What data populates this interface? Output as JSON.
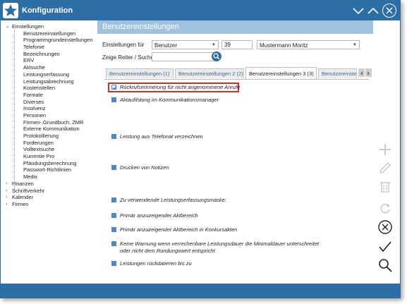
{
  "window": {
    "title": "Konfiguration",
    "controls": {
      "minimize": "chevron-down-icon",
      "maximize": "chevron-up-icon",
      "close": "close-icon"
    }
  },
  "sidebar": {
    "items": [
      {
        "label": "Einstellungen",
        "level": 0,
        "expanded": true
      },
      {
        "label": "Benutzereinstellungen",
        "level": 1
      },
      {
        "label": "Programmgrundeinstellungen",
        "level": 1
      },
      {
        "label": "Telefonie",
        "level": 1
      },
      {
        "label": "Bezeichnungen",
        "level": 1
      },
      {
        "label": "ERV",
        "level": 1
      },
      {
        "label": "Aktsuche",
        "level": 1
      },
      {
        "label": "Leistungserfassung",
        "level": 1
      },
      {
        "label": "Leistungsabrechnung",
        "level": 1
      },
      {
        "label": "Kostenstellen",
        "level": 1
      },
      {
        "label": "Formate",
        "level": 1
      },
      {
        "label": "Diverses",
        "level": 1
      },
      {
        "label": "Insolvenz",
        "level": 1
      },
      {
        "label": "Personen",
        "level": 1
      },
      {
        "label": "Firmen-,Grundbuch, ZMR",
        "level": 1
      },
      {
        "label": "Externe Kommunikation",
        "level": 1
      },
      {
        "label": "Protokollierung",
        "level": 1
      },
      {
        "label": "Forderungen",
        "level": 1
      },
      {
        "label": "Volltextsuche",
        "level": 1
      },
      {
        "label": "Kurrentie Pro",
        "level": 1
      },
      {
        "label": "Pfändungsberechnung",
        "level": 1
      },
      {
        "label": "Passwort-Richtlinien",
        "level": 1
      },
      {
        "label": "Medix",
        "level": 1
      },
      {
        "label": "Finanzen",
        "level": 0,
        "expanded": false
      },
      {
        "label": "Schriftverkehr",
        "level": 0,
        "expanded": false
      },
      {
        "label": "Kalender",
        "level": 0,
        "expanded": false
      },
      {
        "label": "Firmen",
        "level": 0,
        "expanded": false
      }
    ]
  },
  "panel": {
    "title": "Benutzereinstellungen",
    "settings_for_label": "Einstellungen für",
    "settings_for_value": "Benutzer",
    "user_id": "39",
    "user_name": "Mustermann Moritz",
    "search_label": "Zeige Reiter / Suche",
    "search_value": ""
  },
  "tabs": [
    {
      "label": "Benutzereinstellungen (1)",
      "active": false
    },
    {
      "label": "Benutzereinstellungen 2 (2)",
      "active": false
    },
    {
      "label": "Benutzereinstellungen 3 (3)",
      "active": true
    },
    {
      "label": "Benutzereinste",
      "active": false
    }
  ],
  "options": [
    {
      "label": "Rückrufserinnerung für nicht angenommene Anrufe",
      "checked": true,
      "highlighted": true
    },
    {
      "label": "Aktaufilstung im Kommunikationsmanager"
    },
    {
      "label": "Leistung aus Telefonat verzeichnen"
    },
    {
      "label": "Drucken von Notizen"
    },
    {
      "label": "Zu verwendende Leistungserfassungsmaske:"
    },
    {
      "label": "Primär anzuzeigender Aktbereich"
    },
    {
      "label": "Primär anzuzeigender Aktbereich in Konkursakten"
    },
    {
      "label": "Keine Warnung wenn verrechenbare Leistungsdauer die Minimaldauer unterschreitet",
      "label2": "oder nicht dem Rundungswert entspricht"
    },
    {
      "label": "Leistungen rückdatieren bis zu"
    }
  ],
  "actions": [
    {
      "name": "add-icon",
      "enabled": false
    },
    {
      "name": "edit-icon",
      "enabled": false
    },
    {
      "name": "delete-icon",
      "enabled": false
    },
    {
      "name": "refresh-icon",
      "enabled": false
    },
    {
      "name": "cancel-icon",
      "enabled": true
    },
    {
      "name": "confirm-icon",
      "enabled": true
    },
    {
      "name": "search-icon",
      "enabled": true
    }
  ],
  "colors": {
    "titlebar": "#2e6ea6",
    "panel_header": "#9fc2df",
    "option_marker": "#4f86c6",
    "highlight": "#d12b2b"
  }
}
